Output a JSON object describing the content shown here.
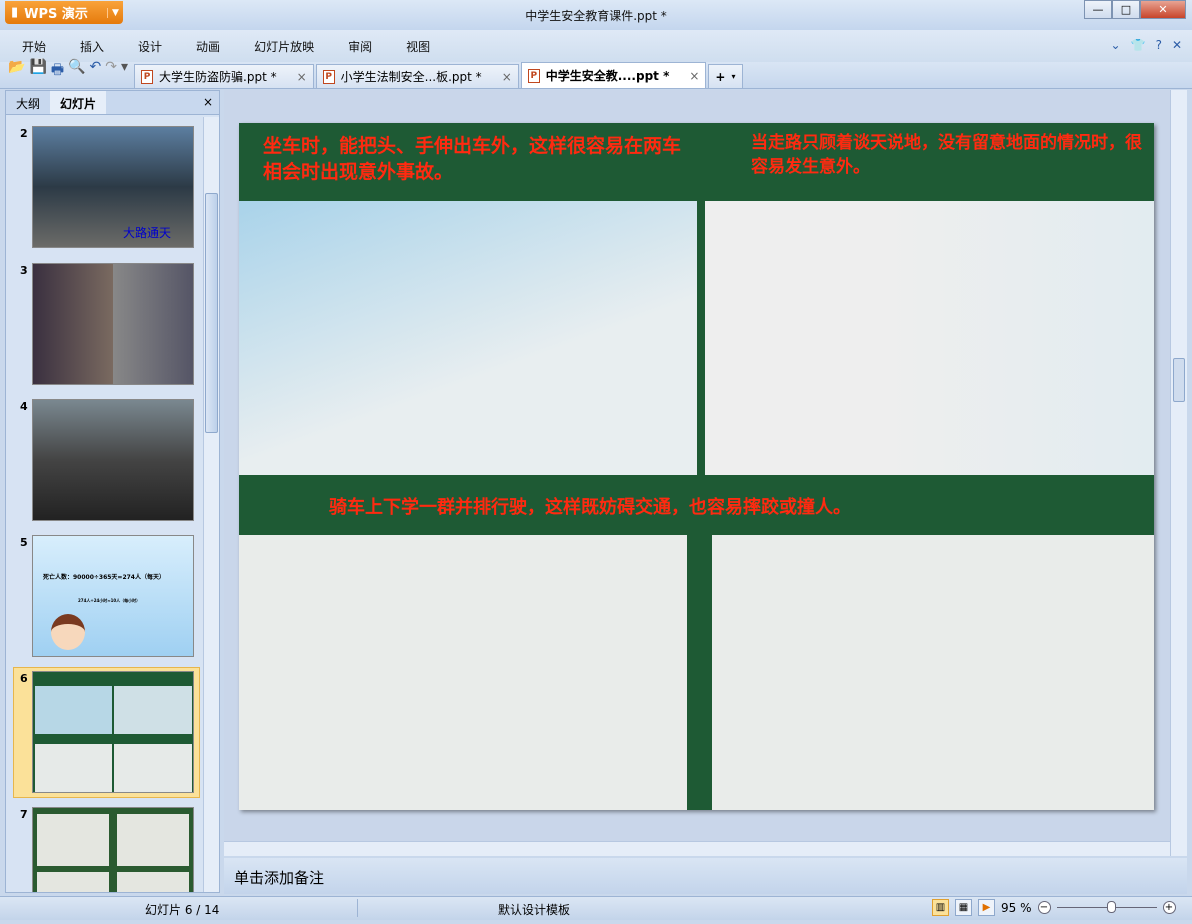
{
  "app": {
    "name": "WPS 演示",
    "title": "中学生安全教育课件.ppt *"
  },
  "menu": [
    "开始",
    "插入",
    "设计",
    "动画",
    "幻灯片放映",
    "审阅",
    "视图"
  ],
  "tabs": [
    {
      "label": "大学生防盗防骗.ppt *"
    },
    {
      "label": "小学生法制安全...板.ppt *"
    },
    {
      "label": "中学生安全教....ppt *"
    }
  ],
  "side": {
    "tab_outline": "大纲",
    "tab_slides": "幻灯片",
    "close": "×",
    "slides": [
      {
        "num": "2",
        "caption": "大路通天"
      },
      {
        "num": "3"
      },
      {
        "num": "4"
      },
      {
        "num": "5",
        "line1": "死亡人数：90000÷365天=274人（每天）",
        "line2": "274人÷24小时≈10人（每小时）"
      },
      {
        "num": "6"
      },
      {
        "num": "7"
      }
    ]
  },
  "slide": {
    "cap1": "坐车时，能把头、手伸出车外，这样很容易在两车相会时出现意外事故。",
    "cap2": "当走路只顾着谈天说地，没有留意地面的情况时，很容易发生意外。",
    "cap3": "骑车上下学一群并排行驶，这样既妨碍交通，也容易摔跤或撞人。"
  },
  "notes": "单击添加备注",
  "status": {
    "slide": "幻灯片 6 / 14",
    "template": "默认设计模板",
    "zoom": "95 %",
    "zoom_value": 95
  }
}
